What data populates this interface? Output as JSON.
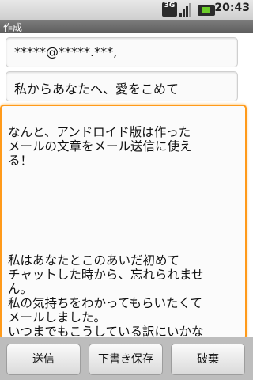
{
  "status_bar": {
    "network": "3G",
    "time": "20:43"
  },
  "title": "作成",
  "fields": {
    "to_value": "*****@*****.***,",
    "subject_value": "私からあなたへ、愛をこめて"
  },
  "body": {
    "text": "なんと、アンドロイド版は作った\nメールの文章をメール送信に使え\nる！\n\n\n\n\n\n\n私はあなたとこのあいだ初めて\nチャットした時から、忘れられませ\nん。\n私の気持ちをわかってもらいたくて\nメールしました。\nいつまでもこうしている訳にいかな"
  },
  "buttons": {
    "send": "送信",
    "save_draft": "下書き保存",
    "discard": "破棄"
  },
  "colors": {
    "focus_border": "#ff9a1a",
    "battery": "#6ccd2a"
  }
}
